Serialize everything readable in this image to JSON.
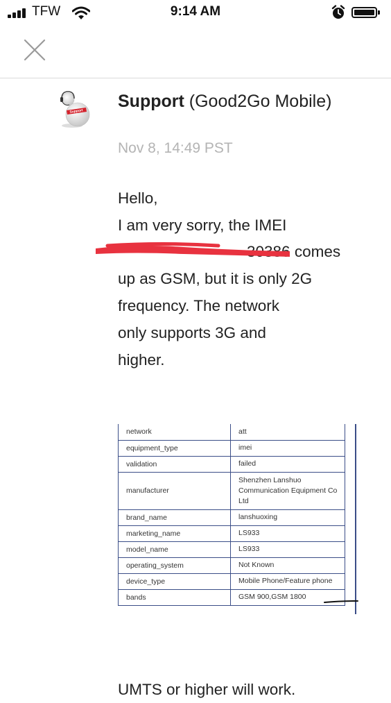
{
  "status_bar": {
    "carrier": "TFW",
    "time": "9:14 AM",
    "icons": [
      "signal-icon",
      "wifi-icon",
      "alarm-icon",
      "battery-icon"
    ]
  },
  "nav": {
    "close_icon": "close-icon"
  },
  "message": {
    "sender_name": "Support",
    "sender_org": "(Good2Go Mobile)",
    "avatar_label": "Support",
    "timestamp": "Nov 8, 14:49 PST",
    "body_lines": [
      "Hello,",
      "I am very sorry, the IMEI",
      "30386 comes",
      "up as GSM, but it is only 2G",
      "frequency. The network",
      "only supports 3G and",
      "higher."
    ],
    "table": [
      {
        "key": "network",
        "value": "att"
      },
      {
        "key": "equipment_type",
        "value": "imei"
      },
      {
        "key": "validation",
        "value": "failed"
      },
      {
        "key": "manufacturer",
        "value": "Shenzhen Lanshuo Communication Equipment Co Ltd"
      },
      {
        "key": "brand_name",
        "value": "lanshuoxing"
      },
      {
        "key": "marketing_name",
        "value": "LS933"
      },
      {
        "key": "model_name",
        "value": "LS933"
      },
      {
        "key": "operating_system",
        "value": "Not Known"
      },
      {
        "key": "device_type",
        "value": "Mobile Phone/Feature phone"
      },
      {
        "key": "bands",
        "value": "GSM 900,GSM 1800"
      }
    ],
    "tail_text": "UMTS or higher will work."
  },
  "colors": {
    "table_border": "#3a4d87",
    "redaction": "#e8323f",
    "timestamp": "#b4b4b4"
  }
}
